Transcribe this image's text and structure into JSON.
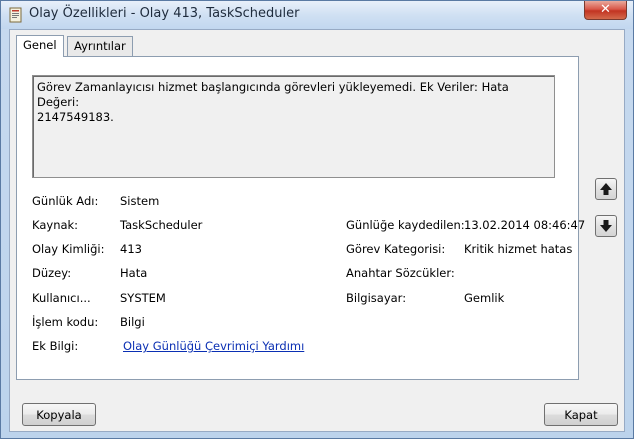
{
  "window": {
    "title": "Olay Özellikleri - Olay 413, TaskScheduler",
    "close_glyph": "✕"
  },
  "tabs": [
    {
      "label": "Genel",
      "active": true
    },
    {
      "label": "Ayrıntılar",
      "active": false
    }
  ],
  "description": "Görev Zamanlayıcısı hizmet başlangıcında görevleri yükleyemedi. Ek Veriler: Hata Değeri:\n2147549183.",
  "fields_left": [
    {
      "label": "Günlük Adı:",
      "value": "Sistem"
    },
    {
      "label": "Kaynak:",
      "value": "TaskScheduler"
    },
    {
      "label": "Olay Kimliği:",
      "value": "413"
    },
    {
      "label": "Düzey:",
      "value": "Hata"
    },
    {
      "label": "Kullanıcı...",
      "value": "SYSTEM"
    },
    {
      "label": "İşlem kodu:",
      "value": "Bilgi"
    },
    {
      "label": "Ek Bilgi:",
      "value": "Olay Günlüğü Çevrimiçi Yardımı"
    }
  ],
  "fields_right": [
    {
      "label": "Günlüğe kaydedilen:",
      "value": "13.02.2014 08:46:47"
    },
    {
      "label": "Görev Kategorisi:",
      "value": "Kritik hizmet hatas"
    },
    {
      "label": "Anahtar Sözcükler:",
      "value": ""
    },
    {
      "label": "Bilgisayar:",
      "value": "Gemlik"
    }
  ],
  "nav": {
    "up_icon": "arrow-up-icon",
    "down_icon": "arrow-down-icon"
  },
  "buttons": {
    "copy": "Kopyala",
    "close": "Kapat"
  },
  "colors": {
    "link": "#0a2fb3",
    "close_button": "#c23422"
  }
}
